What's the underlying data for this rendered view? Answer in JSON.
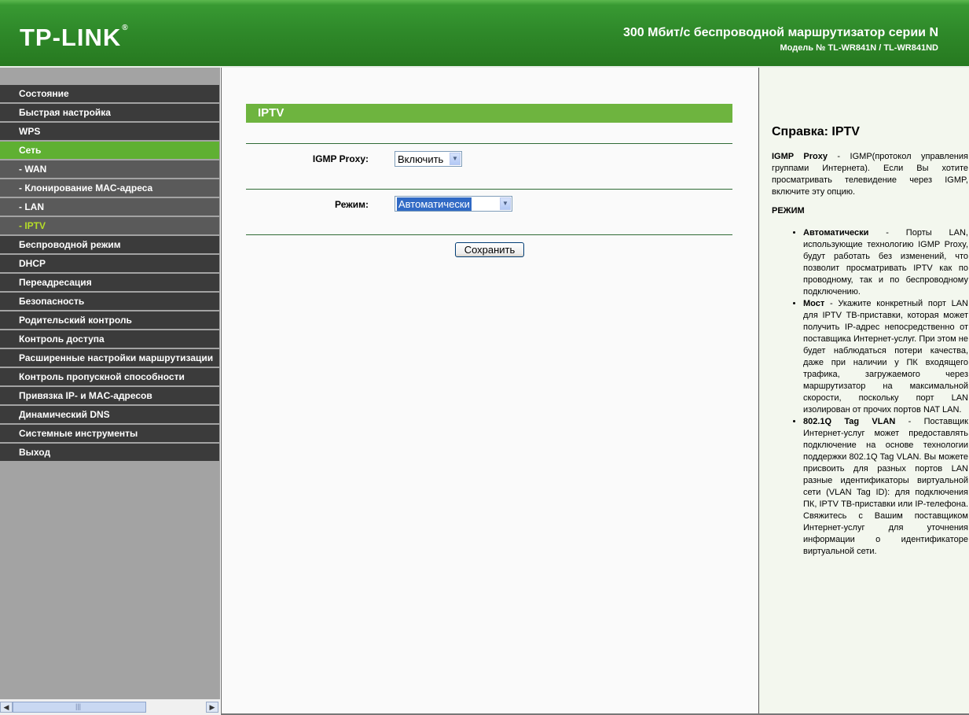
{
  "header": {
    "logo": "TP-LINK",
    "logo_mark": "®",
    "title": "300 Мбит/с беспроводной маршрутизатор серии N",
    "model": "Модель № TL-WR841N / TL-WR841ND"
  },
  "colors": {
    "header_green": "#2f8a2a",
    "menu_dark": "#3b3b3b",
    "menu_active": "#5fb032",
    "submenu_active_text": "#b5dd28",
    "section_bar": "#6eb43f"
  },
  "sidebar": {
    "items": [
      {
        "label": "Состояние"
      },
      {
        "label": "Быстрая настройка"
      },
      {
        "label": "WPS"
      },
      {
        "label": "Сеть"
      },
      {
        "label": "- WAN"
      },
      {
        "label": "- Клонирование MAC-адреса"
      },
      {
        "label": "- LAN"
      },
      {
        "label": "- IPTV"
      },
      {
        "label": "Беспроводной режим"
      },
      {
        "label": "DHCP"
      },
      {
        "label": "Переадресация"
      },
      {
        "label": "Безопасность"
      },
      {
        "label": "Родительский контроль"
      },
      {
        "label": "Контроль доступа"
      },
      {
        "label": "Расширенные настройки маршрутизации"
      },
      {
        "label": "Контроль пропускной способности"
      },
      {
        "label": "Привязка IP- и MAC-адресов"
      },
      {
        "label": "Динамический DNS"
      },
      {
        "label": "Системные инструменты"
      },
      {
        "label": "Выход"
      }
    ]
  },
  "main": {
    "section_title": "IPTV",
    "igmp_label": "IGMP Proxy:",
    "igmp_value": "Включить",
    "mode_label": "Режим:",
    "mode_value": "Автоматически",
    "save_label": "Сохранить"
  },
  "help": {
    "title": "Справка: IPTV",
    "igmp_term": "IGMP Proxy",
    "igmp_desc": " - IGMP(протокол управления группами Интернета). Если Вы хотите просматривать телевидение через IGMP, включите эту опцию.",
    "mode_heading": "РЕЖИМ",
    "items": [
      {
        "term": "Автоматически",
        "desc": " - Порты LAN, использующие технологию IGMP Proxy, будут работать без изменений, что позволит просматривать IPTV как по проводному, так и по беспроводному подключению."
      },
      {
        "term": "Мост",
        "desc": " - Укажите конкретный порт LAN для IPTV ТВ-приставки, которая может получить IP-адрес непосредственно от поставщика Интернет-услуг. При этом не будет наблюдаться потери качества, даже при наличии у ПК входящего трафика, загружаемого через маршрутизатор на максимальной скорости, поскольку порт LAN изолирован от прочих портов NAT LAN."
      },
      {
        "term": "802.1Q Tag VLAN",
        "desc": " - Поставщик Интернет-услуг может предоставлять подключение на основе технологии поддержки 802.1Q Tag VLAN. Вы можете присвоить для разных портов LAN разные идентификаторы виртуальной сети (VLAN Tag ID): для подключения ПК, IPTV ТВ-приставки или IP-телефона. Свяжитесь с Вашим поставщиком Интернет-услуг для уточнения информации о идентификаторе виртуальной сети."
      }
    ]
  },
  "scrollbar": {
    "left_icon": "arrow-left-icon",
    "right_icon": "arrow-right-icon",
    "grip_icon": "grip-icon"
  }
}
